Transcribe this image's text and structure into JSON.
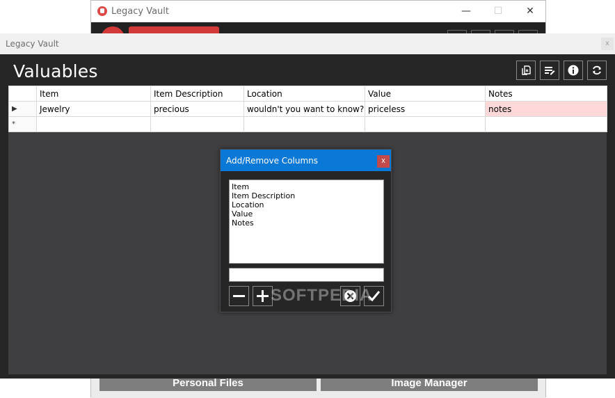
{
  "background_window": {
    "title": "Legacy Vault",
    "minimize_glyph": "—",
    "maximize_glyph": "☐",
    "close_glyph": "✕",
    "bottom_buttons": [
      "Personal Files",
      "Image Manager"
    ]
  },
  "window": {
    "title": "Legacy Vault",
    "close_glyph": "x"
  },
  "page": {
    "title": "Valuables"
  },
  "toolbar": {
    "icons": [
      "copy-document-icon",
      "notes-edit-icon",
      "info-icon",
      "refresh-icon"
    ]
  },
  "grid": {
    "columns": [
      "Item",
      "Item Description",
      "Location",
      "Value",
      "Notes"
    ],
    "rows": [
      {
        "marker": "▶",
        "cells": [
          "Jewelry",
          "precious",
          "wouldn't you want to know?",
          "priceless",
          "notes"
        ]
      }
    ],
    "new_row_marker": "*"
  },
  "dialog": {
    "title": "Add/Remove Columns",
    "close_glyph": "x",
    "columns_list": [
      "Item",
      "Item Description",
      "Location",
      "Value",
      "Notes"
    ],
    "new_column_value": "",
    "buttons": [
      "remove-icon",
      "add-icon",
      "cancel-icon",
      "confirm-icon"
    ]
  },
  "watermark": {
    "text": "SOFTPEDIA"
  },
  "colors": {
    "titlebar_blue": "#0a78d7",
    "dark_background": "#262626",
    "grid_background": "#3f3f42",
    "selected_cell": "#ffd9d9",
    "close_red": "#c24a4a"
  }
}
